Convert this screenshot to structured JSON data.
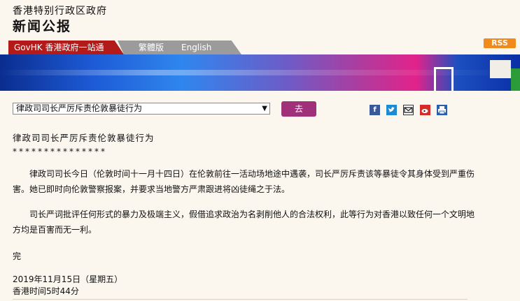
{
  "header": {
    "gov_title": "香港特别行政区政府",
    "press_title": "新闻公报"
  },
  "nav": {
    "govhk": "GovHK 香港政府一站通",
    "traditional": "繁體版",
    "english": "English",
    "rss": "RSS"
  },
  "selector": {
    "selected": "律政司司长严厉斥责伦敦暴徒行为",
    "go_label": "去"
  },
  "share_icons": [
    "facebook-icon",
    "twitter-icon",
    "email-icon",
    "weibo-icon",
    "print-icon"
  ],
  "colors": {
    "nav_red": "#b31b1b",
    "nav_gray": "#9b9b9b",
    "go_button": "#a0307a",
    "rss_orange": "#f08a1c",
    "page_bg": "#fbf7ef"
  },
  "article": {
    "title": "律政司司长严厉斥责伦敦暴徒行为",
    "stars": "***************",
    "para1": "律政司司长今日（伦敦时间十一月十四日）在伦敦前往一活动场地途中遇袭，司长严厉斥责该等暴徒令其身体受到严重伤害。她已即时向伦敦警察报案，并要求当地警方严肃跟进将凶徒绳之于法。",
    "para2": "司长严词批评任何形式的暴力及极端主义，假借追求政治为名剥削他人的合法权利，此等行为对香港以致任何一个文明地方均是百害而无一利。",
    "end": "完",
    "date": "2019年11月15日（星期五）",
    "time": "香港时间5时44分"
  }
}
